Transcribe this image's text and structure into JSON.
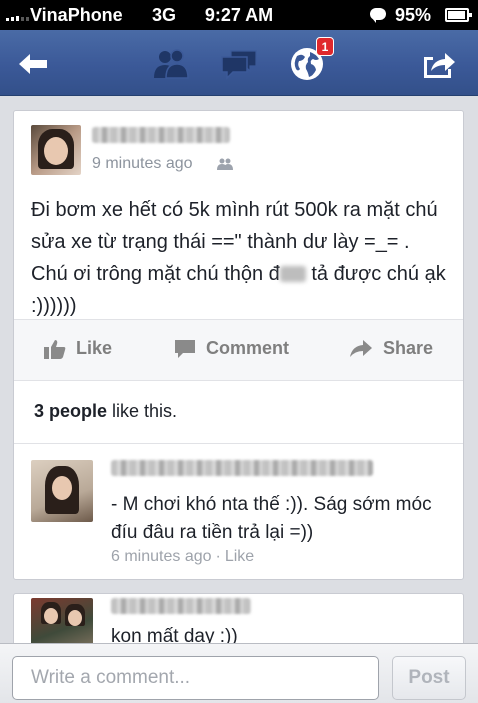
{
  "status_bar": {
    "carrier": "VinaPhone",
    "network": "3G",
    "time": "9:27 AM",
    "battery": "95%",
    "battery_level": 0.95
  },
  "nav": {
    "back_icon": "back-arrow-icon",
    "friends_icon": "friend-requests-icon",
    "messages_icon": "messages-icon",
    "notifications_icon": "globe-notifications-icon",
    "notifications_badge": "1",
    "share_icon": "share-icon",
    "bar_color": "#3b5998"
  },
  "post": {
    "timestamp": "9 minutes ago",
    "text_part1": "Đi bơm xe hết có 5k mình rút 500k ra mặt chú sửa xe từ trạng thái ==\" thành dư lày =_= . Chú ơi trông mặt chú thộn đ",
    "text_part2": " tả được chú ạk :))))))",
    "actions": {
      "like": "Like",
      "comment": "Comment",
      "share": "Share"
    },
    "likes_count": "3 people",
    "likes_suffix": " like this."
  },
  "comments": [
    {
      "text": "- M chơi khó nta thế :)). Ság sớm móc đíu đâu ra tiền trả lại =))",
      "time": "6 minutes ago",
      "separator": "·",
      "like": "Like"
    },
    {
      "text": "kon mất day :))"
    }
  ],
  "composer": {
    "placeholder": "Write a comment...",
    "post_label": "Post"
  }
}
